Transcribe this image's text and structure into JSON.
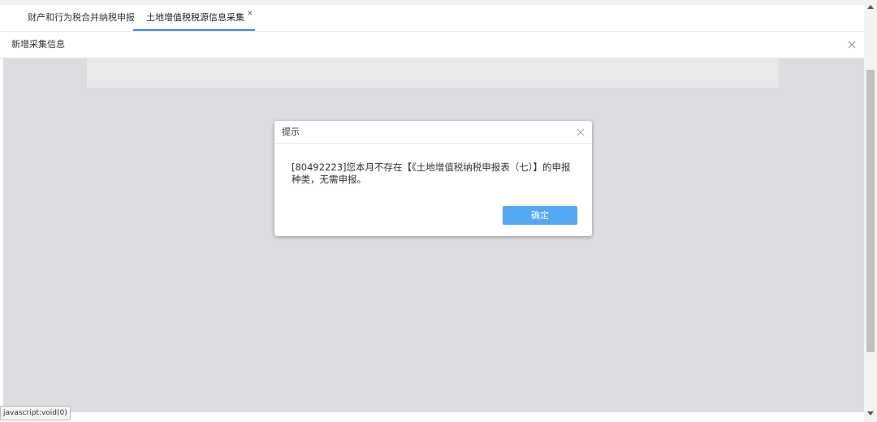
{
  "tabs": [
    {
      "label": "财产和行为税合并纳税申报",
      "active": false
    },
    {
      "label": "土地增值税税源信息采集",
      "active": true,
      "close_icon": "×"
    }
  ],
  "panel": {
    "title": "新增采集信息"
  },
  "dialog": {
    "title": "提示",
    "message": "[80492223]您本月不存在【《土地增值税纳税申报表（七）】的申报种类，无需申报。",
    "ok_label": "确定"
  },
  "status_bar": {
    "text": "javascript:void(0)"
  },
  "icons": {
    "panel_close": "close-icon",
    "dialog_close": "close-icon",
    "tab_close": "close-icon"
  },
  "colors": {
    "accent": "#3a8ee6",
    "button": "#52a8f2",
    "overlay": "#dcdde0"
  }
}
